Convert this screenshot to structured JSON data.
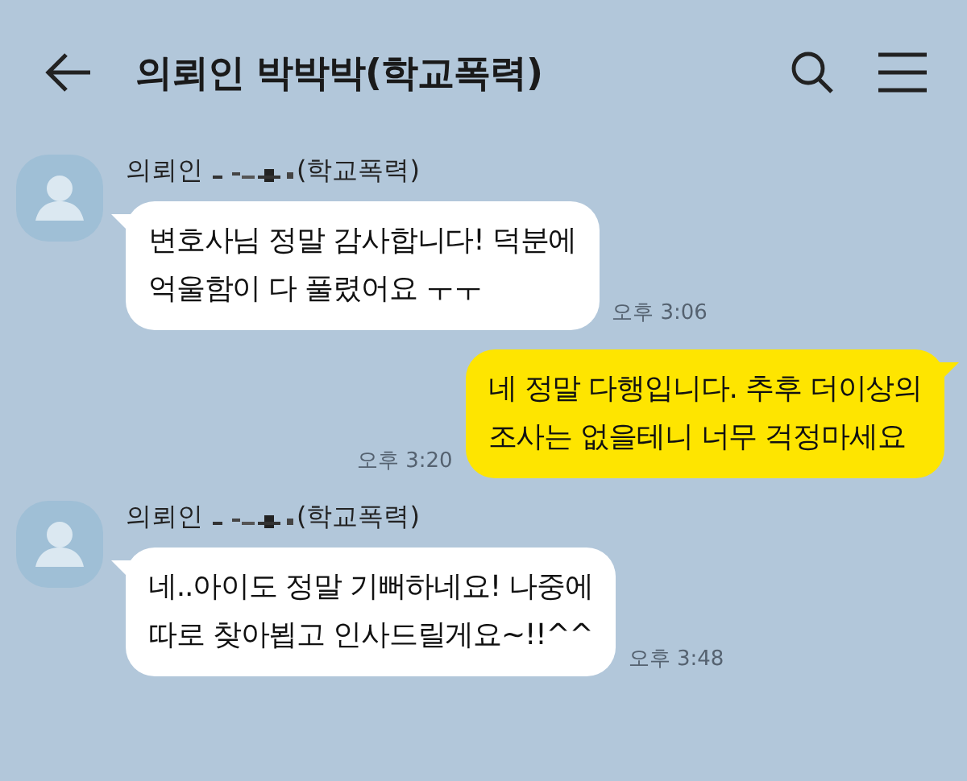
{
  "header": {
    "title": "의뢰인 박박박(학교폭력)"
  },
  "messages": [
    {
      "kind": "incoming",
      "sender_prefix": "의뢰인",
      "sender_suffix": "(학교폭력)",
      "lines": [
        "변호사님 정말 감사합니다! 덕분에",
        "억울함이 다 풀렸어요 ㅜㅜ"
      ],
      "time": "오후 3:06"
    },
    {
      "kind": "outgoing",
      "lines": [
        "네 정말 다행입니다. 추후 더이상의",
        "조사는 없을테니 너무 걱정마세요"
      ],
      "time": "오후 3:20"
    },
    {
      "kind": "incoming",
      "sender_prefix": "의뢰인",
      "sender_suffix": "(학교폭력)",
      "lines": [
        "네..아이도 정말 기뻐하네요! 나중에",
        "따로 찾아뵙고 인사드릴게요~!!^^"
      ],
      "time": "오후 3:48"
    }
  ]
}
